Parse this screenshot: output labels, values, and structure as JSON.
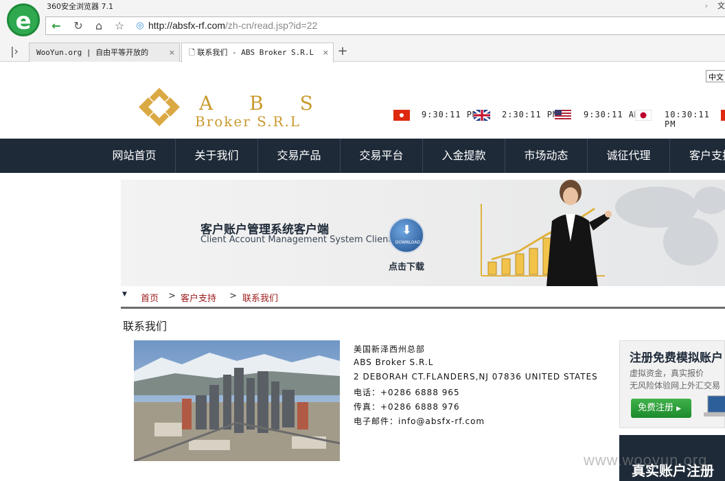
{
  "browser": {
    "app_title": "360安全浏览器 7.1",
    "right_text": "文",
    "url_host": "http://absfx-rf.com",
    "url_path": "/zh-cn/read.jsp?id=22",
    "tabs": [
      {
        "label": "WooYun.org | 自由平等开放的",
        "active": false
      },
      {
        "label": "联系我们 - ABS Broker S.R.L",
        "active": true
      }
    ]
  },
  "lang_select": "中文",
  "brand": {
    "name": "A B S",
    "sub": "Broker S.R.L",
    "color": "#c99a2e"
  },
  "clocks": [
    {
      "flag": "hk-flag-icon",
      "time": "9:30:11 PM"
    },
    {
      "flag": "uk-flag-icon",
      "time": "2:30:11 PM"
    },
    {
      "flag": "us-flag-icon",
      "time": "9:30:11 AM"
    },
    {
      "flag": "jp-flag-icon",
      "time": "10:30:11 PM"
    }
  ],
  "nav": [
    "网站首页",
    "关于我们",
    "交易产品",
    "交易平台",
    "入金提款",
    "市场动态",
    "诚征代理",
    "客户支持"
  ],
  "banner": {
    "title_cn": "客户账户管理系统客户端",
    "title_en": "Client Account Management System Client",
    "download_badge": "DOWNLOAD",
    "download_label": "点击下载"
  },
  "breadcrumb": {
    "home": "首页",
    "sep": ">",
    "section": "客户支持",
    "current": "联系我们"
  },
  "page_title": "联系我们",
  "contact": {
    "office": "美国新泽西州总部",
    "company": "ABS Broker S.R.L",
    "address": "2 DEBORAH CT.FLANDERS,NJ 07836 UNITED STATES",
    "phone": "电话：+0286 6888 965",
    "fax": "传真：+0286 6888 976",
    "email": "电子邮件：info@absfx-rf.com"
  },
  "promo": {
    "title": "注册免费模拟账户",
    "line1": "虚拟资金，真实报价",
    "line2": "无风险体验网上外汇交易",
    "button": "免费注册",
    "title2": "真实账户注册"
  },
  "watermark": "www.wooyun.org",
  "colors": {
    "nav_bg": "#1e2a38",
    "crumb": "#9b1a1a",
    "gold": "#c99a2e"
  }
}
